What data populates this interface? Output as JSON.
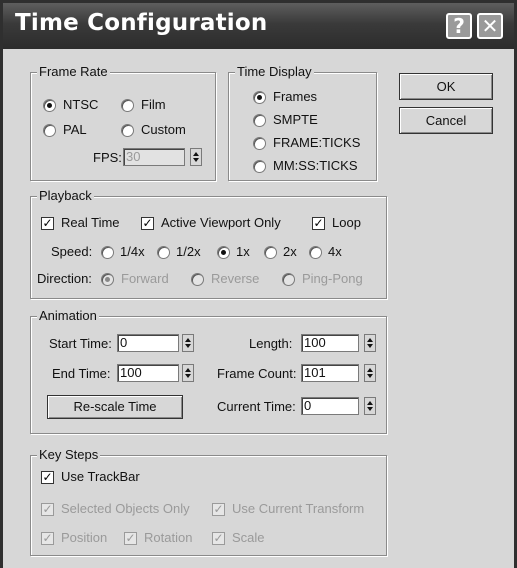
{
  "window": {
    "title": "Time Configuration",
    "help_glyph": "?",
    "close_glyph": "✕"
  },
  "frame_rate": {
    "legend": "Frame Rate",
    "options": [
      {
        "label": "NTSC",
        "selected": true
      },
      {
        "label": "Film",
        "selected": false
      },
      {
        "label": "PAL",
        "selected": false
      },
      {
        "label": "Custom",
        "selected": false
      }
    ],
    "fps_label": "FPS:",
    "fps_value": "30"
  },
  "time_display": {
    "legend": "Time Display",
    "options": [
      {
        "label": "Frames",
        "selected": true
      },
      {
        "label": "SMPTE",
        "selected": false
      },
      {
        "label": "FRAME:TICKS",
        "selected": false
      },
      {
        "label": "MM:SS:TICKS",
        "selected": false
      }
    ]
  },
  "buttons": {
    "ok": "OK",
    "cancel": "Cancel"
  },
  "playback": {
    "legend": "Playback",
    "real_time": {
      "label": "Real Time",
      "checked": true
    },
    "active_viewport_only": {
      "label": "Active Viewport Only",
      "checked": true
    },
    "loop": {
      "label": "Loop",
      "checked": true
    },
    "speed_label": "Speed:",
    "speeds": [
      {
        "label": "1/4x",
        "selected": false
      },
      {
        "label": "1/2x",
        "selected": false
      },
      {
        "label": "1x",
        "selected": true
      },
      {
        "label": "2x",
        "selected": false
      },
      {
        "label": "4x",
        "selected": false
      }
    ],
    "direction_label": "Direction:",
    "directions": [
      {
        "label": "Forward",
        "selected": true
      },
      {
        "label": "Reverse",
        "selected": false
      },
      {
        "label": "Ping-Pong",
        "selected": false
      }
    ]
  },
  "animation": {
    "legend": "Animation",
    "start_time_label": "Start Time:",
    "start_time": "0",
    "end_time_label": "End Time:",
    "end_time": "100",
    "length_label": "Length:",
    "length": "100",
    "frame_count_label": "Frame Count:",
    "frame_count": "101",
    "current_time_label": "Current Time:",
    "current_time": "0",
    "rescale_button": "Re-scale Time"
  },
  "key_steps": {
    "legend": "Key Steps",
    "use_trackbar": {
      "label": "Use TrackBar",
      "checked": true
    },
    "selected_objects_only": {
      "label": "Selected Objects Only",
      "checked": true
    },
    "use_current_transform": {
      "label": "Use Current Transform",
      "checked": true
    },
    "position": {
      "label": "Position",
      "checked": true
    },
    "rotation": {
      "label": "Rotation",
      "checked": true
    },
    "scale": {
      "label": "Scale",
      "checked": true
    }
  }
}
